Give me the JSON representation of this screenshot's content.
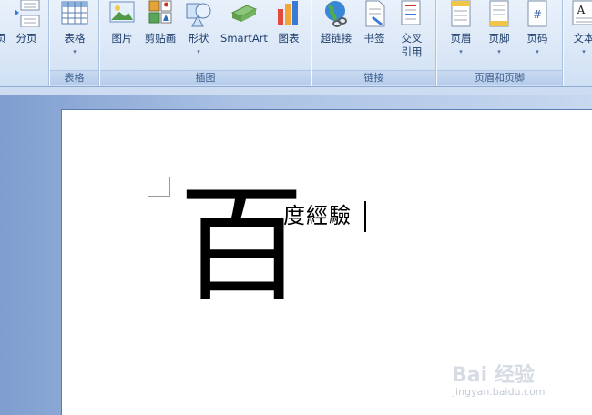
{
  "ribbon": {
    "groups": [
      {
        "label": ""
      },
      {
        "label": "表格"
      },
      {
        "label": "插图"
      },
      {
        "label": "链接"
      },
      {
        "label": "页眉和页脚"
      },
      {
        "label": ""
      }
    ],
    "buttons": {
      "prev_partial": "页",
      "page_break": "分页",
      "table": "表格",
      "picture": "图片",
      "clipart": "剪贴画",
      "shapes": "形状",
      "smartart": "SmartArt",
      "chart": "图表",
      "hyperlink": "超链接",
      "bookmark": "书签",
      "crossref": "交叉\n引用",
      "header": "页眉",
      "footer": "页脚",
      "page_number": "页码",
      "textbox": "文本"
    },
    "dropdown_arrow": "▾"
  },
  "document": {
    "dropcap": "百",
    "text": "度經驗"
  },
  "watermark": {
    "brand": "Bai 经验",
    "url": "jingyan.baidu.com"
  }
}
